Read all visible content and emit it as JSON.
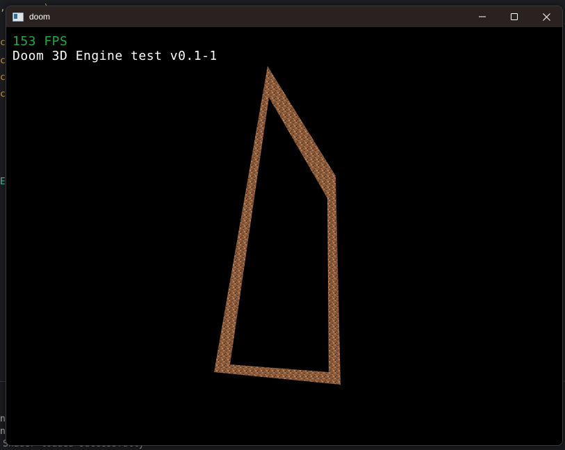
{
  "window": {
    "title": "doom",
    "icon": "app-window-icon",
    "controls": [
      "minimize-icon",
      "maximize-icon",
      "close-icon"
    ]
  },
  "hud": {
    "fps_text": "153 FPS",
    "engine_title": "Doom 3D Engine test v0.1-1"
  },
  "background": {
    "status_text": "Shader loaded successfully"
  },
  "colors": {
    "fps": "#1faa4a",
    "hud_text": "#ffffff",
    "titlebar": "#2a2221",
    "wall_base": "#8a5a3a",
    "wall_light": "#b07a52",
    "wall_dark": "#5a3822",
    "viewport_bg": "#000000"
  }
}
